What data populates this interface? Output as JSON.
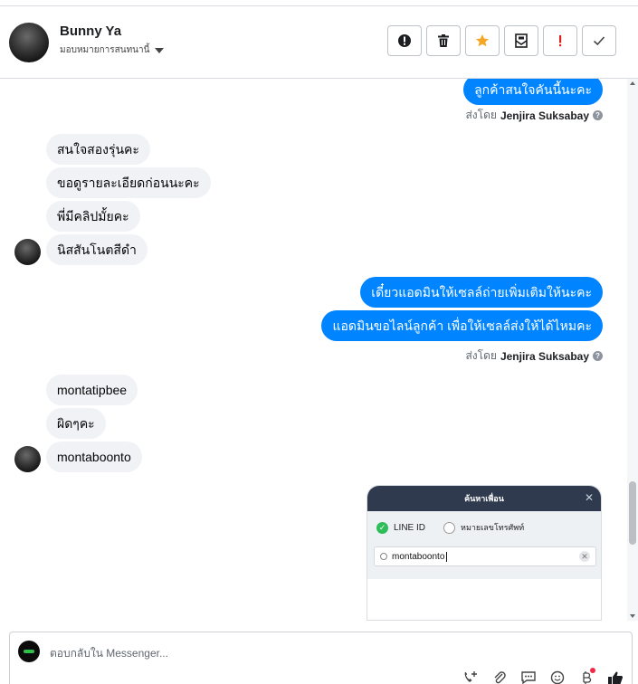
{
  "header": {
    "name": "Bunny Ya",
    "assign_label": "มอบหมายการสนทนานี้",
    "actions": [
      {
        "icon": "alert-icon",
        "name": "spam-button"
      },
      {
        "icon": "trash-icon",
        "name": "delete-button"
      },
      {
        "icon": "star-icon",
        "name": "star-button"
      },
      {
        "icon": "mail-icon",
        "name": "mark-unread-button"
      },
      {
        "icon": "exclamation-icon",
        "name": "follow-up-button"
      },
      {
        "icon": "check-icon",
        "name": "done-button"
      }
    ]
  },
  "messages": {
    "m0": "ลูกค้าสนใจคันนี้นะคะ",
    "m1": "สนใจสองรุ่นคะ",
    "m2": "ขอดูรายละเอียดก่อนนะคะ",
    "m3": "พี่มีคลิปมั้ยคะ",
    "m4": "นิสสันโนตสีดำ",
    "m5": "เดี๋ยวแอดมินให้เซลล์ถ่ายเพิ่มเติมให้นะคะ",
    "m6": "แอดมินขอไลน์ลูกค้า เพื่อให้เซลล์ส่งให้ได้ไหมคะ",
    "m7": "montatipbee",
    "m8": "ผิดๆคะ",
    "m9": "montaboonto"
  },
  "sent_by": {
    "prefix": "ส่งโดย",
    "agent": "Jenjira Suksabay"
  },
  "attachment": {
    "title": "ค้นหาเพื่อน",
    "option_line": "LINE ID",
    "option_phone": "หมายเลขโทรศัพท์",
    "search_value": "montaboonto"
  },
  "composer": {
    "placeholder": "ตอบกลับใน Messenger...",
    "tools": [
      "call-add-icon",
      "paperclip-icon",
      "saved-reply-icon",
      "emoji-icon",
      "bitcoin-icon",
      "like-icon"
    ]
  },
  "colors": {
    "outgoing": "#0084ff",
    "incoming": "#f0f2f5",
    "star": "#f5a623",
    "alert": "#e02020"
  }
}
